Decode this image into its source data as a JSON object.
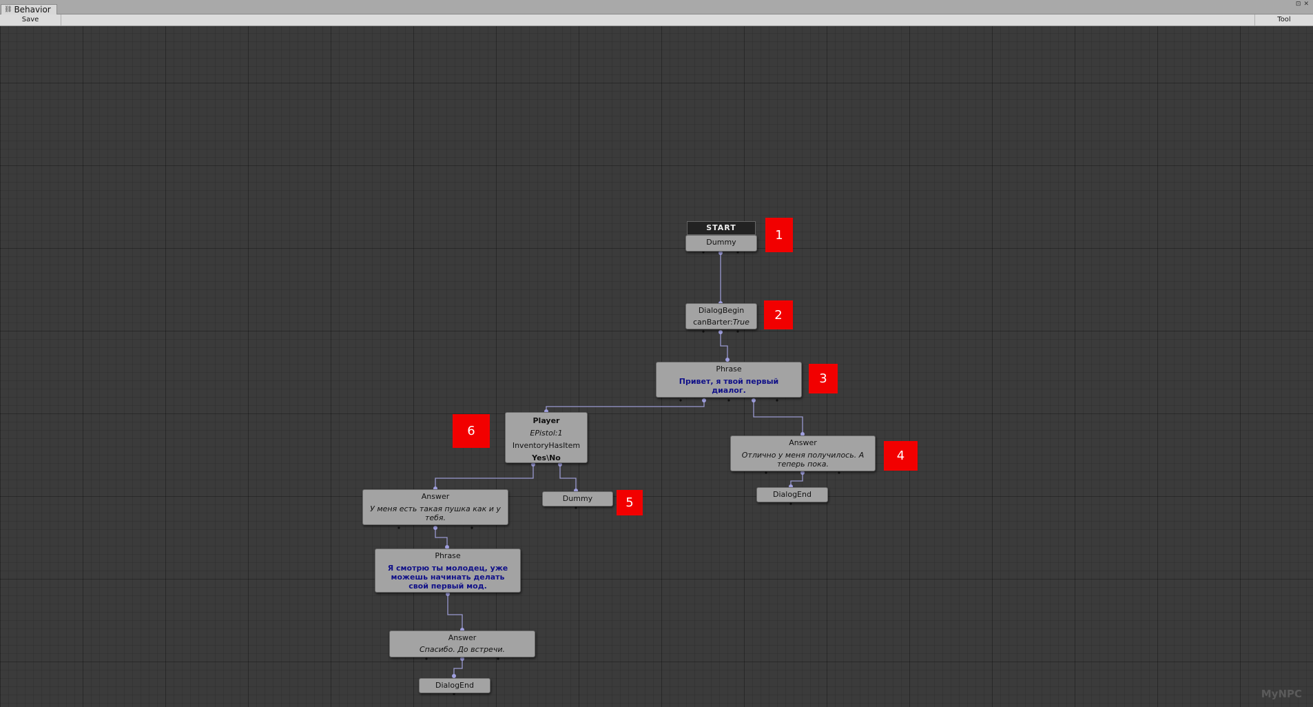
{
  "window": {
    "tab_title": "Behavior",
    "tab_icon": "graph-icon",
    "controls": [
      "⊡",
      "✕"
    ]
  },
  "toolbar": {
    "save_label": "Save",
    "tool_label": "Tool"
  },
  "graph": {
    "start_label": "START",
    "nodes": {
      "dummy_start": {
        "title": "Dummy"
      },
      "dialog_begin": {
        "title": "DialogBegin",
        "param_key": "canBarter:",
        "param_value": "True"
      },
      "phrase_1": {
        "title": "Phrase",
        "text": "Привет, я твой первый диалог."
      },
      "player": {
        "title": "Player",
        "item": "EPistol:1",
        "check": "InventoryHasItem",
        "branches": "Yes\\No"
      },
      "answer_left": {
        "title": "Answer",
        "text": "У меня есть такая пушка как и у тебя."
      },
      "dummy_right": {
        "title": "Dummy"
      },
      "answer_right": {
        "title": "Answer",
        "text": "Отлично у меня получилось. А теперь пока."
      },
      "dialog_end_right": {
        "title": "DialogEnd"
      },
      "phrase_2": {
        "title": "Phrase",
        "text": "Я смотрю ты молодец, уже можешь начинать делать свой первый мод."
      },
      "answer_bottom": {
        "title": "Answer",
        "text": "Спасибо. До встречи."
      },
      "dialog_end_bottom": {
        "title": "DialogEnd"
      }
    },
    "badges": [
      "1",
      "2",
      "3",
      "4",
      "5",
      "6"
    ]
  },
  "watermark": "MyNPC",
  "colors": {
    "background": "#3b3b3b",
    "node": "#a3a3a3",
    "phrase_text": "#101088",
    "badge": "#f20000",
    "wire": "#9a9ad0"
  }
}
